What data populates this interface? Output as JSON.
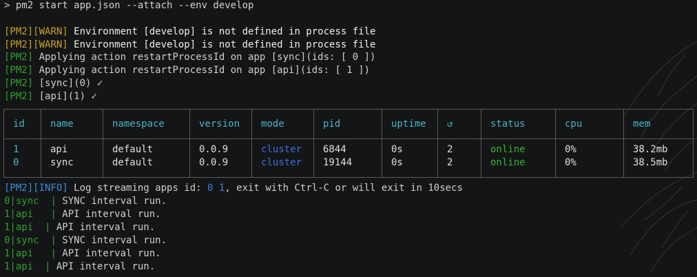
{
  "command": "> pm2 start app.json --attach --env develop",
  "warnings": [
    {
      "tag1": "[PM2]",
      "tag2": "[WARN]",
      "text": " Environment [develop] is not defined in process file"
    },
    {
      "tag1": "[PM2]",
      "tag2": "[WARN]",
      "text": " Environment [develop] is not defined in process file"
    }
  ],
  "actions": [
    {
      "tag": "[PM2]",
      "text": " Applying action restartProcessId on app [sync](ids: [ 0 ])"
    },
    {
      "tag": "[PM2]",
      "text": " Applying action restartProcessId on app [api](ids: [ 1 ])"
    },
    {
      "tag": "[PM2]",
      "text": " [sync](0) ✓"
    },
    {
      "tag": "[PM2]",
      "text": " [api](1) ✓"
    }
  ],
  "table": {
    "headers": [
      "id",
      "name",
      "namespace",
      "version",
      "mode",
      "pid",
      "uptime",
      "↺",
      "status",
      "cpu",
      "mem"
    ],
    "rows": [
      [
        "1",
        "api",
        "default",
        "0.0.9",
        "cluster",
        "6844",
        "0s",
        "2",
        "online",
        "0%",
        "38.2mb"
      ],
      [
        "0",
        "sync",
        "default",
        "0.0.9",
        "cluster",
        "19144",
        "0s",
        "2",
        "online",
        "0%",
        "38.5mb"
      ]
    ]
  },
  "info": {
    "tag1": "[PM2]",
    "tag2": "[INFO]",
    "text_a": " Log streaming apps id: ",
    "ids": "0 1",
    "text_b": ", exit with Ctrl-C or will exit in 10secs"
  },
  "logs": [
    {
      "prefix": "0|sync  ",
      "sep": "| ",
      "text": "SYNC interval run."
    },
    {
      "prefix": "1|api   ",
      "sep": "| ",
      "text": "API interval run."
    },
    {
      "prefix": "1|api  ",
      "sep": "| ",
      "text": "API interval run."
    },
    {
      "prefix": "0|sync  ",
      "sep": "| ",
      "text": "SYNC interval run."
    },
    {
      "prefix": "1|api   ",
      "sep": "| ",
      "text": "API interval run."
    },
    {
      "prefix": "1|api  ",
      "sep": "| ",
      "text": "API interval run."
    }
  ],
  "colors": {
    "background": "#141516",
    "warn": "#c9a227",
    "pm2_green": "#2fa12f",
    "info_blue": "#3b8fd9",
    "header_cyan": "#4ab4c8",
    "mode_blue": "#3d6fe0",
    "online_green": "#2fb82f"
  }
}
